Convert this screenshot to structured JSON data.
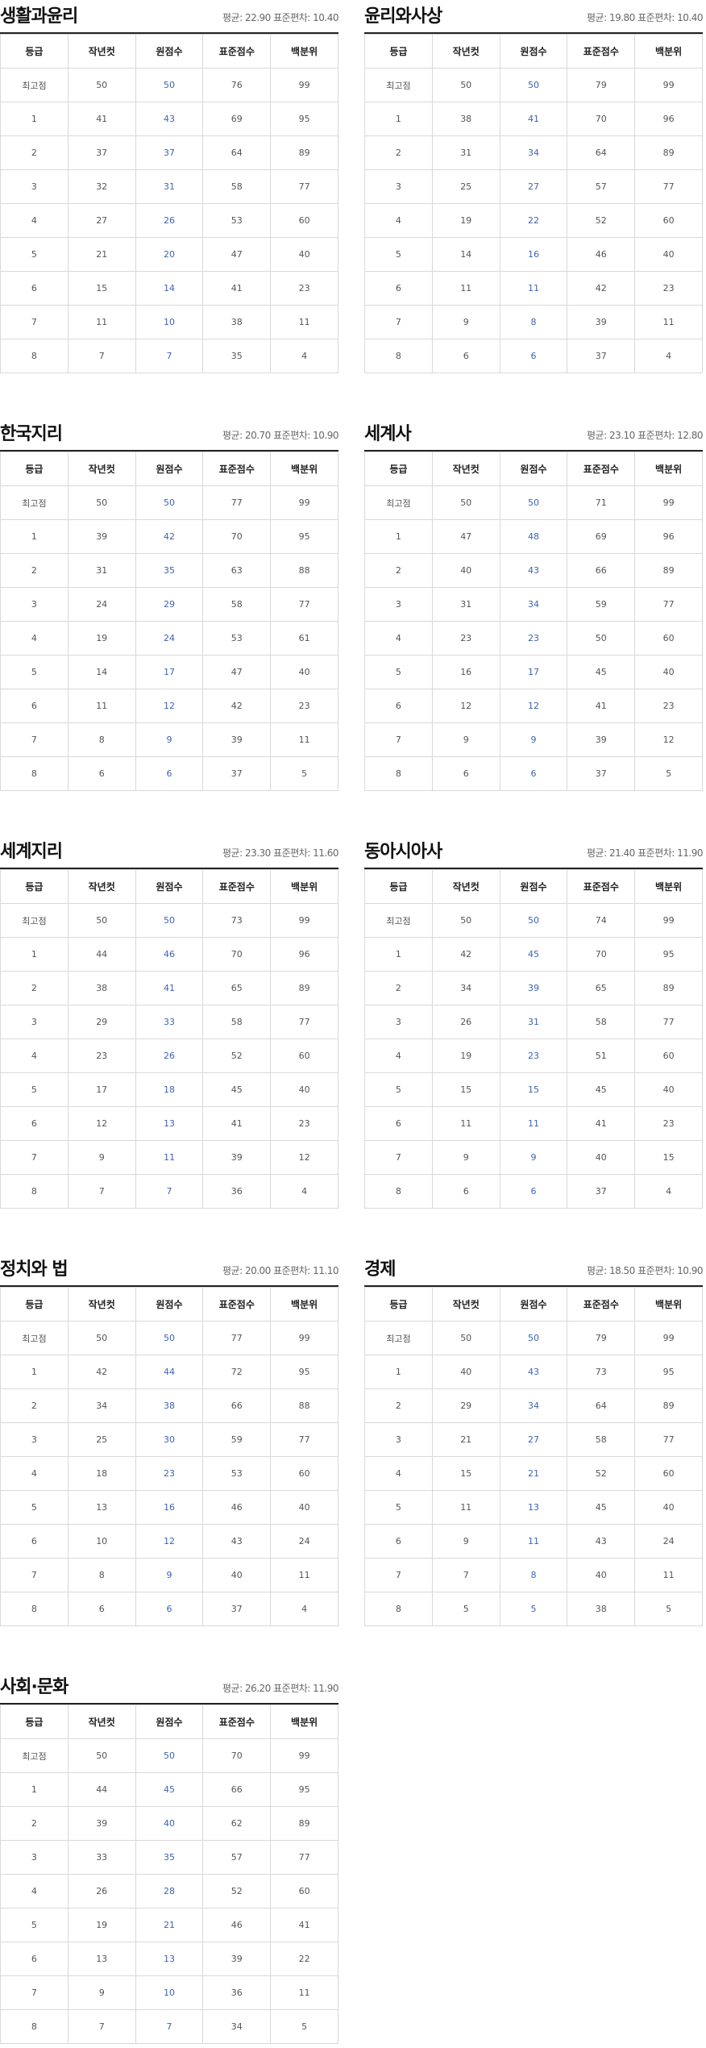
{
  "columns": [
    "등급",
    "작년컷",
    "원점수",
    "표준점수",
    "백분위"
  ],
  "accent_color": "#3f63b4",
  "stats_format": {
    "mean_label": "평균:",
    "sd_label": "표준편차:"
  },
  "subjects": [
    {
      "title": "생활과윤리",
      "mean": "22.90",
      "sd": "10.40",
      "rows": [
        [
          "최고점",
          "50",
          "50",
          "76",
          "99"
        ],
        [
          "1",
          "41",
          "43",
          "69",
          "95"
        ],
        [
          "2",
          "37",
          "37",
          "64",
          "89"
        ],
        [
          "3",
          "32",
          "31",
          "58",
          "77"
        ],
        [
          "4",
          "27",
          "26",
          "53",
          "60"
        ],
        [
          "5",
          "21",
          "20",
          "47",
          "40"
        ],
        [
          "6",
          "15",
          "14",
          "41",
          "23"
        ],
        [
          "7",
          "11",
          "10",
          "38",
          "11"
        ],
        [
          "8",
          "7",
          "7",
          "35",
          "4"
        ]
      ]
    },
    {
      "title": "윤리와사상",
      "mean": "19.80",
      "sd": "10.40",
      "rows": [
        [
          "최고점",
          "50",
          "50",
          "79",
          "99"
        ],
        [
          "1",
          "38",
          "41",
          "70",
          "96"
        ],
        [
          "2",
          "31",
          "34",
          "64",
          "89"
        ],
        [
          "3",
          "25",
          "27",
          "57",
          "77"
        ],
        [
          "4",
          "19",
          "22",
          "52",
          "60"
        ],
        [
          "5",
          "14",
          "16",
          "46",
          "40"
        ],
        [
          "6",
          "11",
          "11",
          "42",
          "23"
        ],
        [
          "7",
          "9",
          "8",
          "39",
          "11"
        ],
        [
          "8",
          "6",
          "6",
          "37",
          "4"
        ]
      ]
    },
    {
      "title": "한국지리",
      "mean": "20.70",
      "sd": "10.90",
      "rows": [
        [
          "최고점",
          "50",
          "50",
          "77",
          "99"
        ],
        [
          "1",
          "39",
          "42",
          "70",
          "95"
        ],
        [
          "2",
          "31",
          "35",
          "63",
          "88"
        ],
        [
          "3",
          "24",
          "29",
          "58",
          "77"
        ],
        [
          "4",
          "19",
          "24",
          "53",
          "61"
        ],
        [
          "5",
          "14",
          "17",
          "47",
          "40"
        ],
        [
          "6",
          "11",
          "12",
          "42",
          "23"
        ],
        [
          "7",
          "8",
          "9",
          "39",
          "11"
        ],
        [
          "8",
          "6",
          "6",
          "37",
          "5"
        ]
      ]
    },
    {
      "title": "세계사",
      "mean": "23.10",
      "sd": "12.80",
      "rows": [
        [
          "최고점",
          "50",
          "50",
          "71",
          "99"
        ],
        [
          "1",
          "47",
          "48",
          "69",
          "96"
        ],
        [
          "2",
          "40",
          "43",
          "66",
          "89"
        ],
        [
          "3",
          "31",
          "34",
          "59",
          "77"
        ],
        [
          "4",
          "23",
          "23",
          "50",
          "60"
        ],
        [
          "5",
          "16",
          "17",
          "45",
          "40"
        ],
        [
          "6",
          "12",
          "12",
          "41",
          "23"
        ],
        [
          "7",
          "9",
          "9",
          "39",
          "12"
        ],
        [
          "8",
          "6",
          "6",
          "37",
          "5"
        ]
      ]
    },
    {
      "title": "세계지리",
      "mean": "23.30",
      "sd": "11.60",
      "rows": [
        [
          "최고점",
          "50",
          "50",
          "73",
          "99"
        ],
        [
          "1",
          "44",
          "46",
          "70",
          "96"
        ],
        [
          "2",
          "38",
          "41",
          "65",
          "89"
        ],
        [
          "3",
          "29",
          "33",
          "58",
          "77"
        ],
        [
          "4",
          "23",
          "26",
          "52",
          "60"
        ],
        [
          "5",
          "17",
          "18",
          "45",
          "40"
        ],
        [
          "6",
          "12",
          "13",
          "41",
          "23"
        ],
        [
          "7",
          "9",
          "11",
          "39",
          "12"
        ],
        [
          "8",
          "7",
          "7",
          "36",
          "4"
        ]
      ]
    },
    {
      "title": "동아시아사",
      "mean": "21.40",
      "sd": "11.90",
      "rows": [
        [
          "최고점",
          "50",
          "50",
          "74",
          "99"
        ],
        [
          "1",
          "42",
          "45",
          "70",
          "95"
        ],
        [
          "2",
          "34",
          "39",
          "65",
          "89"
        ],
        [
          "3",
          "26",
          "31",
          "58",
          "77"
        ],
        [
          "4",
          "19",
          "23",
          "51",
          "60"
        ],
        [
          "5",
          "15",
          "15",
          "45",
          "40"
        ],
        [
          "6",
          "11",
          "11",
          "41",
          "23"
        ],
        [
          "7",
          "9",
          "9",
          "40",
          "15"
        ],
        [
          "8",
          "6",
          "6",
          "37",
          "4"
        ]
      ]
    },
    {
      "title": "정치와 법",
      "mean": "20.00",
      "sd": "11.10",
      "rows": [
        [
          "최고점",
          "50",
          "50",
          "77",
          "99"
        ],
        [
          "1",
          "42",
          "44",
          "72",
          "95"
        ],
        [
          "2",
          "34",
          "38",
          "66",
          "88"
        ],
        [
          "3",
          "25",
          "30",
          "59",
          "77"
        ],
        [
          "4",
          "18",
          "23",
          "53",
          "60"
        ],
        [
          "5",
          "13",
          "16",
          "46",
          "40"
        ],
        [
          "6",
          "10",
          "12",
          "43",
          "24"
        ],
        [
          "7",
          "8",
          "9",
          "40",
          "11"
        ],
        [
          "8",
          "6",
          "6",
          "37",
          "4"
        ]
      ]
    },
    {
      "title": "경제",
      "mean": "18.50",
      "sd": "10.90",
      "rows": [
        [
          "최고점",
          "50",
          "50",
          "79",
          "99"
        ],
        [
          "1",
          "40",
          "43",
          "73",
          "95"
        ],
        [
          "2",
          "29",
          "34",
          "64",
          "89"
        ],
        [
          "3",
          "21",
          "27",
          "58",
          "77"
        ],
        [
          "4",
          "15",
          "21",
          "52",
          "60"
        ],
        [
          "5",
          "11",
          "13",
          "45",
          "40"
        ],
        [
          "6",
          "9",
          "11",
          "43",
          "24"
        ],
        [
          "7",
          "7",
          "8",
          "40",
          "11"
        ],
        [
          "8",
          "5",
          "5",
          "38",
          "5"
        ]
      ]
    },
    {
      "title": "사회·문화",
      "mean": "26.20",
      "sd": "11.90",
      "rows": [
        [
          "최고점",
          "50",
          "50",
          "70",
          "99"
        ],
        [
          "1",
          "44",
          "45",
          "66",
          "95"
        ],
        [
          "2",
          "39",
          "40",
          "62",
          "89"
        ],
        [
          "3",
          "33",
          "35",
          "57",
          "77"
        ],
        [
          "4",
          "26",
          "28",
          "52",
          "60"
        ],
        [
          "5",
          "19",
          "21",
          "46",
          "41"
        ],
        [
          "6",
          "13",
          "13",
          "39",
          "22"
        ],
        [
          "7",
          "9",
          "10",
          "36",
          "11"
        ],
        [
          "8",
          "7",
          "7",
          "34",
          "5"
        ]
      ]
    }
  ]
}
